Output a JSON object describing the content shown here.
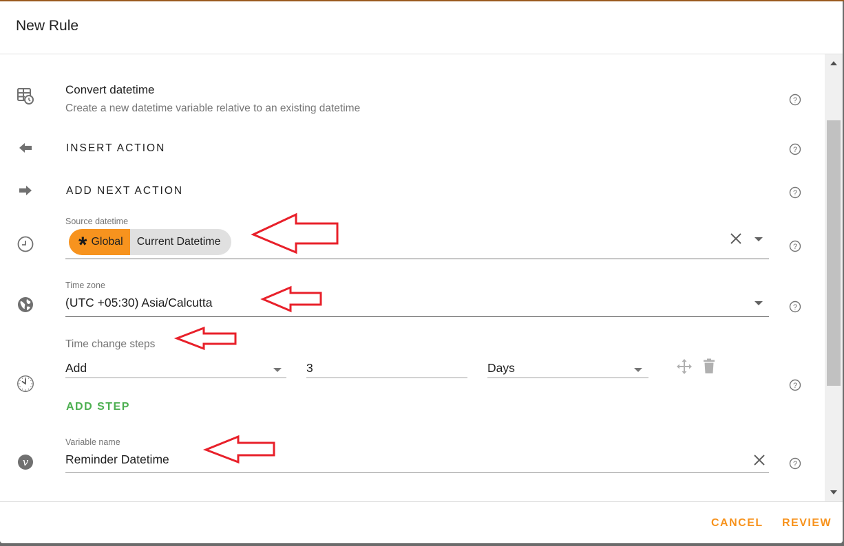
{
  "dialog": {
    "title": "New Rule"
  },
  "action": {
    "title": "Convert datetime",
    "description": "Create a new datetime variable relative to an existing datetime",
    "icon": "table-clock-icon"
  },
  "insert_action": {
    "label": "INSERT ACTION",
    "icon": "arrow-left-icon"
  },
  "add_next_action": {
    "label": "ADD NEXT ACTION",
    "icon": "arrow-right-icon"
  },
  "source_datetime": {
    "label": "Source datetime",
    "chip_scope": "Global",
    "chip_value": "Current Datetime",
    "icon": "clock-outline-icon"
  },
  "time_zone": {
    "label": "Time zone",
    "value": "(UTC +05:30) Asia/Calcutta",
    "icon": "globe-icon"
  },
  "time_change_steps": {
    "label": "Time change steps",
    "icon": "clock-icon",
    "steps": [
      {
        "operation": "Add",
        "amount": "3",
        "unit": "Days"
      }
    ],
    "add_step_label": "ADD STEP"
  },
  "variable_name": {
    "label": "Variable name",
    "value": "Reminder Datetime",
    "icon": "variable-icon"
  },
  "footer": {
    "cancel_label": "CANCEL",
    "review_label": "REVIEW"
  },
  "colors": {
    "accent": "#f7931e",
    "add_step": "#4caf50",
    "annotation": "#e8202a"
  }
}
